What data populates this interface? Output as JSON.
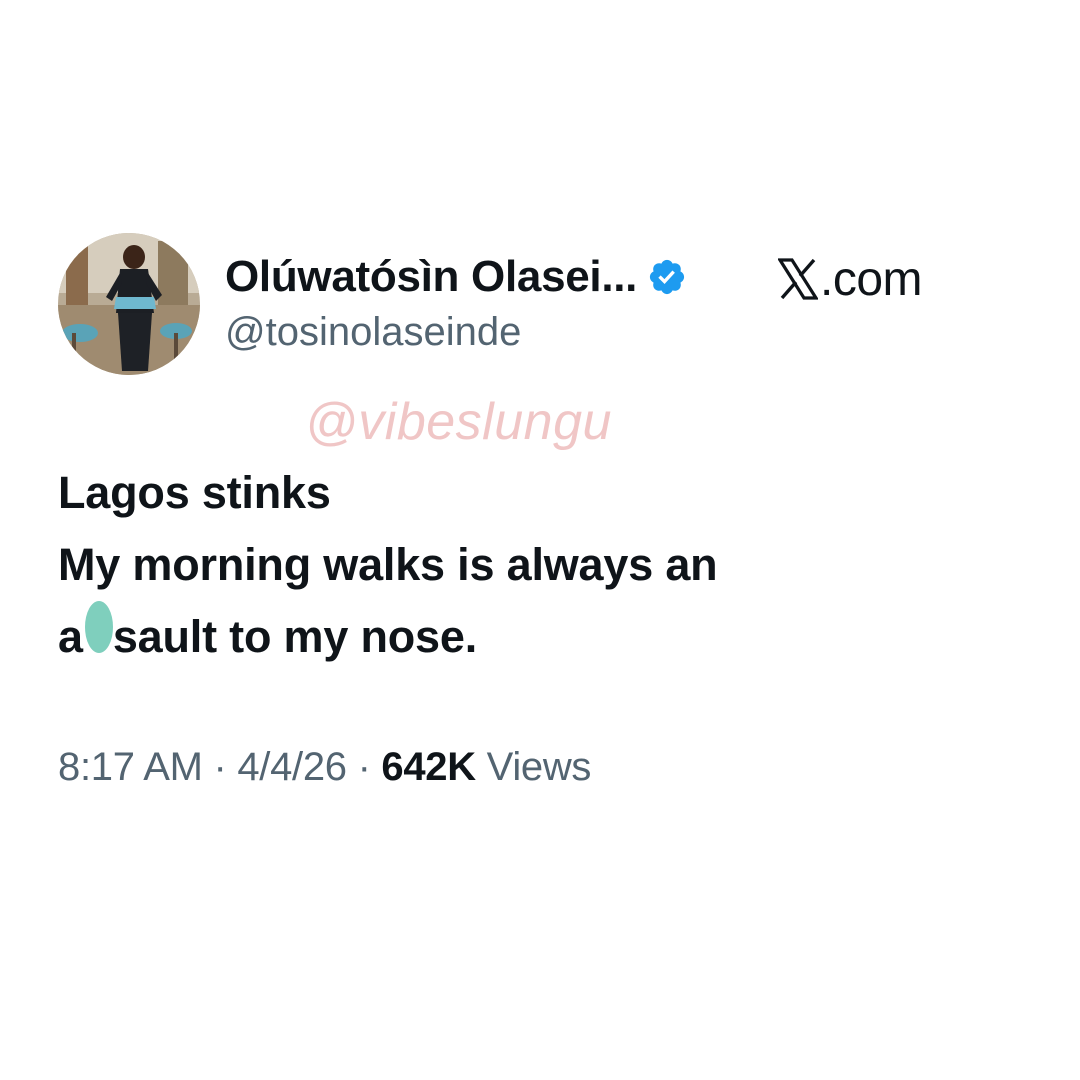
{
  "author": {
    "display_name": "Olúwatósìn Olasei...",
    "handle": "@tosinolaseinde",
    "verified": true,
    "verified_color": "#1d9bf0",
    "avatar_icon": "profile-photo"
  },
  "site": {
    "logo_icon": "x-logo-icon",
    "suffix": ".com"
  },
  "watermark": "@vibeslungu",
  "tweet": {
    "lines": [
      "Lagos stinks",
      "My morning walks is always an"
    ],
    "line3_prefix": "a",
    "line3_suffix": "sault to my nose.",
    "censor_color": "#7fcfbd"
  },
  "meta": {
    "time": "8:17 AM",
    "separator": " · ",
    "date": "4/4/26",
    "views_count": "642K",
    "views_label": " Views"
  },
  "colors": {
    "text_primary": "#0f1419",
    "text_secondary": "#536471",
    "watermark": "#f0c6c6"
  }
}
